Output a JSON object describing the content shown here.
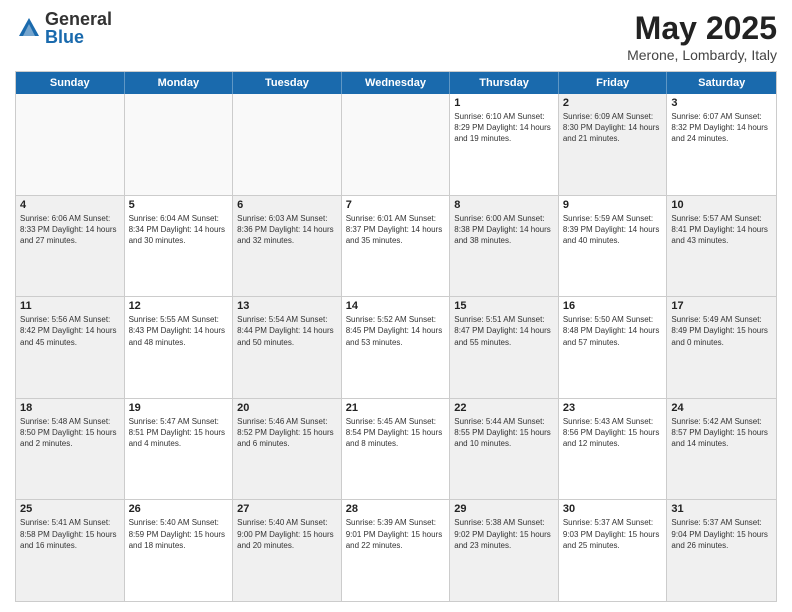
{
  "logo": {
    "general": "General",
    "blue": "Blue"
  },
  "title": "May 2025",
  "subtitle": "Merone, Lombardy, Italy",
  "header_days": [
    "Sunday",
    "Monday",
    "Tuesday",
    "Wednesday",
    "Thursday",
    "Friday",
    "Saturday"
  ],
  "weeks": [
    [
      {
        "num": "",
        "info": "",
        "empty": true
      },
      {
        "num": "",
        "info": "",
        "empty": true
      },
      {
        "num": "",
        "info": "",
        "empty": true
      },
      {
        "num": "",
        "info": "",
        "empty": true
      },
      {
        "num": "1",
        "info": "Sunrise: 6:10 AM\nSunset: 8:29 PM\nDaylight: 14 hours\nand 19 minutes.",
        "empty": false
      },
      {
        "num": "2",
        "info": "Sunrise: 6:09 AM\nSunset: 8:30 PM\nDaylight: 14 hours\nand 21 minutes.",
        "empty": false,
        "shaded": true
      },
      {
        "num": "3",
        "info": "Sunrise: 6:07 AM\nSunset: 8:32 PM\nDaylight: 14 hours\nand 24 minutes.",
        "empty": false
      }
    ],
    [
      {
        "num": "4",
        "info": "Sunrise: 6:06 AM\nSunset: 8:33 PM\nDaylight: 14 hours\nand 27 minutes.",
        "empty": false,
        "shaded": true
      },
      {
        "num": "5",
        "info": "Sunrise: 6:04 AM\nSunset: 8:34 PM\nDaylight: 14 hours\nand 30 minutes.",
        "empty": false
      },
      {
        "num": "6",
        "info": "Sunrise: 6:03 AM\nSunset: 8:36 PM\nDaylight: 14 hours\nand 32 minutes.",
        "empty": false,
        "shaded": true
      },
      {
        "num": "7",
        "info": "Sunrise: 6:01 AM\nSunset: 8:37 PM\nDaylight: 14 hours\nand 35 minutes.",
        "empty": false
      },
      {
        "num": "8",
        "info": "Sunrise: 6:00 AM\nSunset: 8:38 PM\nDaylight: 14 hours\nand 38 minutes.",
        "empty": false,
        "shaded": true
      },
      {
        "num": "9",
        "info": "Sunrise: 5:59 AM\nSunset: 8:39 PM\nDaylight: 14 hours\nand 40 minutes.",
        "empty": false
      },
      {
        "num": "10",
        "info": "Sunrise: 5:57 AM\nSunset: 8:41 PM\nDaylight: 14 hours\nand 43 minutes.",
        "empty": false,
        "shaded": true
      }
    ],
    [
      {
        "num": "11",
        "info": "Sunrise: 5:56 AM\nSunset: 8:42 PM\nDaylight: 14 hours\nand 45 minutes.",
        "empty": false,
        "shaded": true
      },
      {
        "num": "12",
        "info": "Sunrise: 5:55 AM\nSunset: 8:43 PM\nDaylight: 14 hours\nand 48 minutes.",
        "empty": false
      },
      {
        "num": "13",
        "info": "Sunrise: 5:54 AM\nSunset: 8:44 PM\nDaylight: 14 hours\nand 50 minutes.",
        "empty": false,
        "shaded": true
      },
      {
        "num": "14",
        "info": "Sunrise: 5:52 AM\nSunset: 8:45 PM\nDaylight: 14 hours\nand 53 minutes.",
        "empty": false
      },
      {
        "num": "15",
        "info": "Sunrise: 5:51 AM\nSunset: 8:47 PM\nDaylight: 14 hours\nand 55 minutes.",
        "empty": false,
        "shaded": true
      },
      {
        "num": "16",
        "info": "Sunrise: 5:50 AM\nSunset: 8:48 PM\nDaylight: 14 hours\nand 57 minutes.",
        "empty": false
      },
      {
        "num": "17",
        "info": "Sunrise: 5:49 AM\nSunset: 8:49 PM\nDaylight: 15 hours\nand 0 minutes.",
        "empty": false,
        "shaded": true
      }
    ],
    [
      {
        "num": "18",
        "info": "Sunrise: 5:48 AM\nSunset: 8:50 PM\nDaylight: 15 hours\nand 2 minutes.",
        "empty": false,
        "shaded": true
      },
      {
        "num": "19",
        "info": "Sunrise: 5:47 AM\nSunset: 8:51 PM\nDaylight: 15 hours\nand 4 minutes.",
        "empty": false
      },
      {
        "num": "20",
        "info": "Sunrise: 5:46 AM\nSunset: 8:52 PM\nDaylight: 15 hours\nand 6 minutes.",
        "empty": false,
        "shaded": true
      },
      {
        "num": "21",
        "info": "Sunrise: 5:45 AM\nSunset: 8:54 PM\nDaylight: 15 hours\nand 8 minutes.",
        "empty": false
      },
      {
        "num": "22",
        "info": "Sunrise: 5:44 AM\nSunset: 8:55 PM\nDaylight: 15 hours\nand 10 minutes.",
        "empty": false,
        "shaded": true
      },
      {
        "num": "23",
        "info": "Sunrise: 5:43 AM\nSunset: 8:56 PM\nDaylight: 15 hours\nand 12 minutes.",
        "empty": false
      },
      {
        "num": "24",
        "info": "Sunrise: 5:42 AM\nSunset: 8:57 PM\nDaylight: 15 hours\nand 14 minutes.",
        "empty": false,
        "shaded": true
      }
    ],
    [
      {
        "num": "25",
        "info": "Sunrise: 5:41 AM\nSunset: 8:58 PM\nDaylight: 15 hours\nand 16 minutes.",
        "empty": false,
        "shaded": true
      },
      {
        "num": "26",
        "info": "Sunrise: 5:40 AM\nSunset: 8:59 PM\nDaylight: 15 hours\nand 18 minutes.",
        "empty": false
      },
      {
        "num": "27",
        "info": "Sunrise: 5:40 AM\nSunset: 9:00 PM\nDaylight: 15 hours\nand 20 minutes.",
        "empty": false,
        "shaded": true
      },
      {
        "num": "28",
        "info": "Sunrise: 5:39 AM\nSunset: 9:01 PM\nDaylight: 15 hours\nand 22 minutes.",
        "empty": false
      },
      {
        "num": "29",
        "info": "Sunrise: 5:38 AM\nSunset: 9:02 PM\nDaylight: 15 hours\nand 23 minutes.",
        "empty": false,
        "shaded": true
      },
      {
        "num": "30",
        "info": "Sunrise: 5:37 AM\nSunset: 9:03 PM\nDaylight: 15 hours\nand 25 minutes.",
        "empty": false
      },
      {
        "num": "31",
        "info": "Sunrise: 5:37 AM\nSunset: 9:04 PM\nDaylight: 15 hours\nand 26 minutes.",
        "empty": false,
        "shaded": true
      }
    ]
  ]
}
